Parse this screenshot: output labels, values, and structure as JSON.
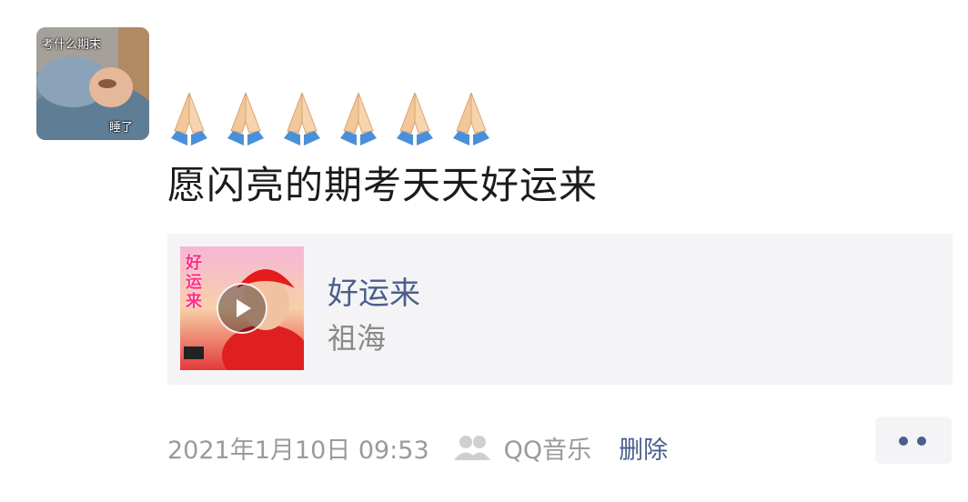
{
  "avatar": {
    "caption_top": "考什么期末",
    "caption_bottom": "睡了"
  },
  "post": {
    "emoji_count": 6,
    "text": "愿闪亮的期考天天好运来"
  },
  "music_card": {
    "cover_title": "好运来",
    "song_title": "好运来",
    "artist": "祖海"
  },
  "footer": {
    "timestamp": "2021年1月10日 09:53",
    "source": "QQ音乐",
    "delete_label": "删除"
  },
  "colors": {
    "link": "#4a5f8c",
    "meta_gray": "#9a9a9a",
    "card_bg": "#f4f4f6"
  }
}
